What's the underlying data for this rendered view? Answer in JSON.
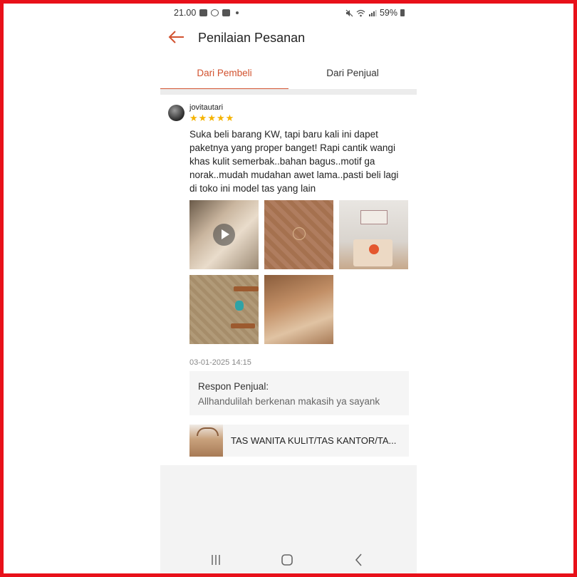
{
  "status_bar": {
    "time": "21.00",
    "battery": "59%"
  },
  "header": {
    "title": "Penilaian Pesanan"
  },
  "tabs": [
    {
      "label": "Dari Pembeli",
      "active": true
    },
    {
      "label": "Dari Penjual",
      "active": false
    }
  ],
  "review": {
    "username": "jovitautari",
    "rating": 5,
    "comment": "Suka beli barang KW, tapi baru kali ini dapet paketnya yang proper banget! Rapi cantik wangi khas kulit semerbak..bahan bagus..motif ga norak..mudah mudahan awet lama..pasti beli lagi di toko ini model tas yang lain",
    "date": "03-01-2025 14:15"
  },
  "seller_response": {
    "label": "Respon Penjual:",
    "text": "Allhandulilah berkenan makasih ya sayank"
  },
  "product": {
    "name": "TAS WANITA KULIT/TAS KANTOR/TA..."
  },
  "colors": {
    "accent": "#d2522f",
    "star": "#f5b301",
    "frame": "#e8101a"
  }
}
